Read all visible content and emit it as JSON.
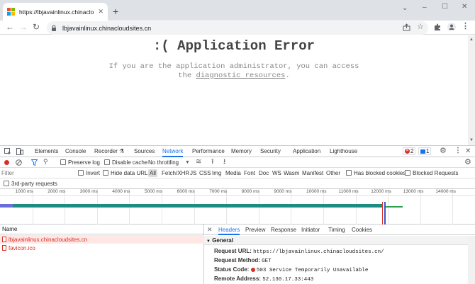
{
  "browser": {
    "tab_title": "https://lbjavainlinux.chinacloudsites.cn",
    "url": "lbjavainlinux.chinacloudsites.cn",
    "new_tab": "+",
    "window_controls": [
      "–",
      "☐",
      "✕"
    ],
    "collapse_tabs": "⌄"
  },
  "page": {
    "title": ":( Application Error",
    "text_before": "If you are the application administrator, you can access the",
    "link": "diagnostic resources",
    "text_after": "."
  },
  "devtools": {
    "tabs": [
      "Elements",
      "Console",
      "Recorder ⚗",
      "Sources",
      "Network",
      "Performance",
      "Memory",
      "Security",
      "Application",
      "Lighthouse"
    ],
    "active_tab": "Network",
    "errors_count": "2",
    "issues_count": "1",
    "preserve_log": "Preserve log",
    "disable_cache": "Disable cache",
    "throttling": "No throttling",
    "filter_placeholder": "Filter",
    "invert": "Invert",
    "hide_data_urls": "Hide data URLs",
    "filter_types": [
      "All",
      "Fetch/XHR",
      "JS",
      "CSS",
      "Img",
      "Media",
      "Font",
      "Doc",
      "WS",
      "Wasm",
      "Manifest",
      "Other"
    ],
    "active_filter": "All",
    "blocked_cookies": "Has blocked cookies",
    "blocked_requests": "Blocked Requests",
    "third_party": "3rd-party requests",
    "timeline_ticks": [
      "1000 ms",
      "2000 ms",
      "3000 ms",
      "4000 ms",
      "5000 ms",
      "6000 ms",
      "7000 ms",
      "8000 ms",
      "9000 ms",
      "10000 ms",
      "11000 ms",
      "12000 ms",
      "13000 ms",
      "14000 ms"
    ],
    "request_list_header": "Name",
    "requests": [
      {
        "name": "lbjavainlinux.chinacloudsites.cn",
        "status": "error"
      },
      {
        "name": "favicon.ico",
        "status": "error"
      }
    ],
    "detail_tabs": [
      "Headers",
      "Preview",
      "Response",
      "Initiator",
      "Timing",
      "Cookies"
    ],
    "active_detail_tab": "Headers",
    "general_section": "General",
    "general": [
      {
        "key": "Request URL:",
        "value": "https://lbjavainlinux.chinacloudsites.cn/"
      },
      {
        "key": "Request Method:",
        "value": "GET"
      },
      {
        "key": "Status Code:",
        "value": "503 Service Temporarily Unavailable"
      },
      {
        "key": "Remote Address:",
        "value": "52.130.17.33:443"
      }
    ]
  },
  "colors": {
    "accent": "#1a73e8",
    "error": "#d93025",
    "timeline_bar": "#1d8d83",
    "selected_row": "#ffe7e6"
  }
}
